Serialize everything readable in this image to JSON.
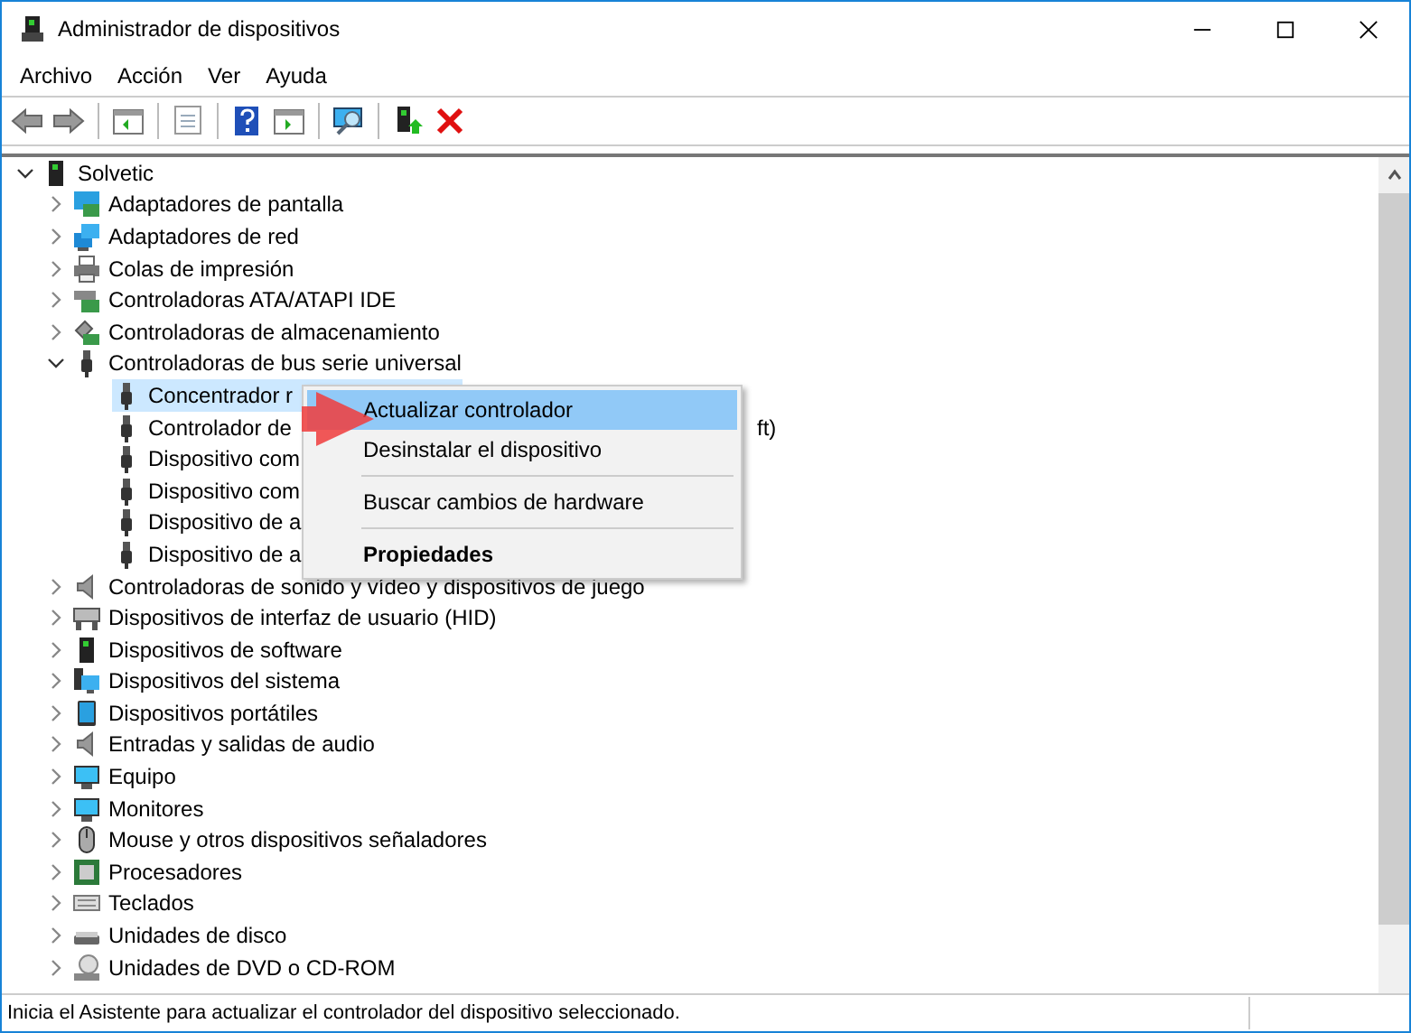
{
  "window": {
    "title": "Administrador de dispositivos"
  },
  "menu_bar": [
    "Archivo",
    "Acción",
    "Ver",
    "Ayuda"
  ],
  "tree": {
    "label": "Solvetic",
    "expanded": true,
    "children": [
      {
        "label": "Adaptadores de pantalla",
        "expanded": false
      },
      {
        "label": "Adaptadores de red",
        "expanded": false
      },
      {
        "label": "Colas de impresión",
        "expanded": false
      },
      {
        "label": "Controladoras ATA/ATAPI IDE",
        "expanded": false
      },
      {
        "label": "Controladoras de almacenamiento",
        "expanded": false
      },
      {
        "label": "Controladoras de bus serie universal",
        "expanded": true,
        "children": [
          {
            "label": "Concentrador r",
            "selected": true
          },
          {
            "label": "Controlador de",
            "label_end": "ft)",
            "selected": false
          },
          {
            "label": "Dispositivo com",
            "selected": false
          },
          {
            "label": "Dispositivo com",
            "selected": false
          },
          {
            "label": "Dispositivo de a",
            "selected": false
          },
          {
            "label": "Dispositivo de a",
            "selected": false
          }
        ]
      },
      {
        "label": "Controladoras de sonido y vídeo y dispositivos de juego",
        "expanded": false
      },
      {
        "label": "Dispositivos de interfaz de usuario (HID)",
        "expanded": false
      },
      {
        "label": "Dispositivos de software",
        "expanded": false
      },
      {
        "label": "Dispositivos del sistema",
        "expanded": false
      },
      {
        "label": "Dispositivos portátiles",
        "expanded": false
      },
      {
        "label": "Entradas y salidas de audio",
        "expanded": false
      },
      {
        "label": "Equipo",
        "expanded": false
      },
      {
        "label": "Monitores",
        "expanded": false
      },
      {
        "label": "Mouse y otros dispositivos señaladores",
        "expanded": false
      },
      {
        "label": "Procesadores",
        "expanded": false
      },
      {
        "label": "Teclados",
        "expanded": false
      },
      {
        "label": "Unidades de disco",
        "expanded": false
      },
      {
        "label": "Unidades de DVD o CD-ROM",
        "expanded": false
      }
    ]
  },
  "context_menu": [
    {
      "kind": "item",
      "label": "Actualizar controlador",
      "selected": true,
      "default": false
    },
    {
      "kind": "item",
      "label": "Desinstalar el dispositivo",
      "selected": false,
      "default": false
    },
    {
      "kind": "separator"
    },
    {
      "kind": "item",
      "label": "Buscar cambios de hardware",
      "selected": false,
      "default": false
    },
    {
      "kind": "separator"
    },
    {
      "kind": "item",
      "label": "Propiedades",
      "selected": false,
      "default": true
    }
  ],
  "status_bar": "Inicia el Asistente para actualizar el controlador del dispositivo seleccionado."
}
